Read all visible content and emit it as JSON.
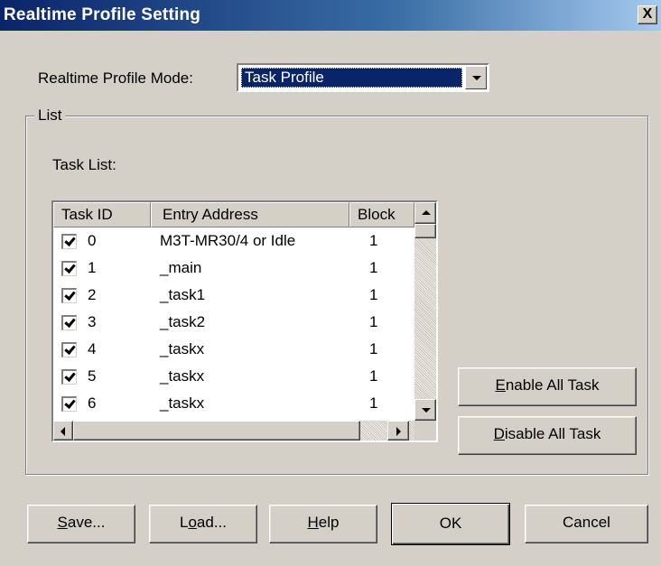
{
  "window": {
    "title": "Realtime Profile Setting",
    "close_label": "X"
  },
  "mode": {
    "label": "Realtime Profile Mode:",
    "selected": "Task Profile"
  },
  "group": {
    "legend": "List",
    "task_list_label": "Task List:"
  },
  "table": {
    "columns": [
      "Task ID",
      "Entry Address",
      "Block"
    ],
    "rows": [
      {
        "id": "0",
        "entry": "M3T-MR30/4 or Idle",
        "block": "1",
        "checked": true
      },
      {
        "id": "1",
        "entry": "_main",
        "block": "1",
        "checked": true
      },
      {
        "id": "2",
        "entry": "_task1",
        "block": "1",
        "checked": true
      },
      {
        "id": "3",
        "entry": "_task2",
        "block": "1",
        "checked": true
      },
      {
        "id": "4",
        "entry": "_taskx",
        "block": "1",
        "checked": true
      },
      {
        "id": "5",
        "entry": "_taskx",
        "block": "1",
        "checked": true
      },
      {
        "id": "6",
        "entry": "_taskx",
        "block": "1",
        "checked": true
      }
    ]
  },
  "side_buttons": {
    "enable_all": {
      "mnemonic": "E",
      "rest": "nable All Task"
    },
    "disable_all": {
      "mnemonic": "D",
      "rest": "isable All Task"
    }
  },
  "footer": {
    "save": {
      "mnemonic": "S",
      "rest": "ave..."
    },
    "load": {
      "before": "L",
      "mnemonic": "o",
      "rest": "ad..."
    },
    "help": {
      "mnemonic": "H",
      "rest": "elp"
    },
    "ok": "OK",
    "cancel": "Cancel"
  }
}
